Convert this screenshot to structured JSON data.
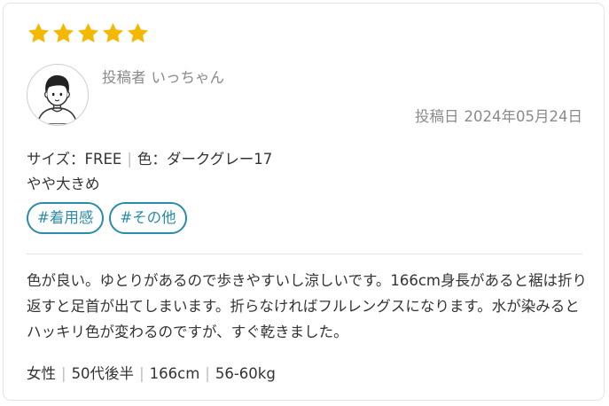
{
  "review": {
    "rating": 5,
    "rating_max": 5,
    "star_color": "#f5b800",
    "avatar_icon": "user-avatar-icon",
    "poster_label": "投稿者",
    "poster_name": "いっちゃん",
    "date_label": "投稿日",
    "date_value": "2024年05月24日",
    "size_label": "サイズ：FREE",
    "color_label": "色：ダークグレー17",
    "fit": "やや大きめ",
    "tags": [
      "#着用感",
      "#その他"
    ],
    "tag_color": "#2a8ca8",
    "body": "色が良い。ゆとりがあるので歩きやすいし涼しいです。166cm身長があると裾は折り返すと足首が出てしまいます。折らなければフルレングスになります。水が染みるとハッキリ色が変わるのですが、すぐ乾きました。",
    "profile": [
      "女性",
      "50代後半",
      "166cm",
      "56-60kg"
    ]
  }
}
